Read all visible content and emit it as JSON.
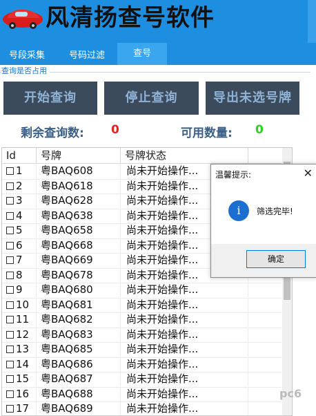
{
  "app": {
    "title": "风清扬查号软件"
  },
  "tabs": [
    {
      "label": "号段采集"
    },
    {
      "label": "号码过滤"
    },
    {
      "label": "查号"
    }
  ],
  "group": {
    "label": "查询是否占用"
  },
  "buttons": {
    "start": "开始查询",
    "stop": "停止查询",
    "export": "导出未选号牌"
  },
  "stats": {
    "remaining_label": "剩余查询数:",
    "remaining_value": "0",
    "available_label": "可用数量:",
    "available_value": "0",
    "remaining_color": "#e8221b",
    "available_color": "#2fd11f"
  },
  "table": {
    "headers": [
      "Id",
      "号牌",
      "号牌状态"
    ],
    "rows": [
      {
        "id": "1",
        "plate": "粤BAQ608",
        "status": "尚未开始操作..."
      },
      {
        "id": "2",
        "plate": "粤BAQ618",
        "status": "尚未开始操作..."
      },
      {
        "id": "3",
        "plate": "粤BAQ628",
        "status": "尚未开始操作..."
      },
      {
        "id": "4",
        "plate": "粤BAQ638",
        "status": "尚未开始操作..."
      },
      {
        "id": "5",
        "plate": "粤BAQ658",
        "status": "尚未开始操作..."
      },
      {
        "id": "6",
        "plate": "粤BAQ668",
        "status": "尚未开始操作..."
      },
      {
        "id": "7",
        "plate": "粤BAQ669",
        "status": "尚未开始操作..."
      },
      {
        "id": "8",
        "plate": "粤BAQ678",
        "status": "尚未开始操作..."
      },
      {
        "id": "9",
        "plate": "粤BAQ680",
        "status": "尚未开始操作..."
      },
      {
        "id": "10",
        "plate": "粤BAQ681",
        "status": "尚未开始操作..."
      },
      {
        "id": "11",
        "plate": "粤BAQ682",
        "status": "尚未开始操作..."
      },
      {
        "id": "12",
        "plate": "粤BAQ683",
        "status": "尚未开始操作..."
      },
      {
        "id": "13",
        "plate": "粤BAQ685",
        "status": "尚未开始操作..."
      },
      {
        "id": "14",
        "plate": "粤BAQ686",
        "status": "尚未开始操作..."
      },
      {
        "id": "15",
        "plate": "粤BAQ687",
        "status": "尚未开始操作..."
      },
      {
        "id": "16",
        "plate": "粤BAQ688",
        "status": "尚未开始操作..."
      },
      {
        "id": "17",
        "plate": "粤BAQ689",
        "status": "尚未开始操作..."
      }
    ]
  },
  "dialog": {
    "title": "温馨提示:",
    "message": "筛选完毕!",
    "ok": "确定",
    "close_glyph": "✕",
    "info_glyph": "i"
  },
  "watermark": "pc6"
}
